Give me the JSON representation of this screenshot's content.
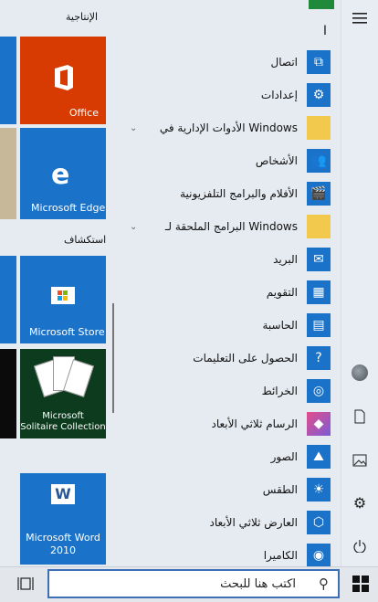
{
  "start_menu": {
    "groups": [
      {
        "title": "الإنتاجية"
      },
      {
        "title": "استكشاف"
      }
    ],
    "tiles": [
      {
        "label": "Office"
      },
      {
        "label": "Microsoft Edge"
      },
      {
        "label": "Microsoft Store"
      },
      {
        "label_line1": "Microsoft",
        "label_line2": "Solitaire Collection"
      },
      {
        "label_line1": "Microsoft Word",
        "label_line2": "2010"
      }
    ],
    "app_list": {
      "section_letter": "ا",
      "apps": [
        {
          "name": "اتصال"
        },
        {
          "name": "إعدادات"
        },
        {
          "name": "الأدوات الإدارية في Windows"
        },
        {
          "name": "الأشخاص"
        },
        {
          "name": "الأفلام والبرامج التلفزيونية"
        },
        {
          "name": "البرامج الملحقة لـ Windows"
        },
        {
          "name": "البريد"
        },
        {
          "name": "التقويم"
        },
        {
          "name": "الحاسبة"
        },
        {
          "name": "الحصول على التعليمات"
        },
        {
          "name": "الخرائط"
        },
        {
          "name": "الرسام ثلاثي الأبعاد"
        },
        {
          "name": "الصور"
        },
        {
          "name": "الطقس"
        },
        {
          "name": "العارض ثلاثي الأبعاد"
        },
        {
          "name": "الكاميرا"
        }
      ]
    }
  },
  "taskbar": {
    "search_placeholder": "اكتب هنا للبحث"
  },
  "colors": {
    "accent": "#1a73c9",
    "office": "#d83b01",
    "tile_blue": "#1a73c9",
    "word": "#2b5797"
  }
}
